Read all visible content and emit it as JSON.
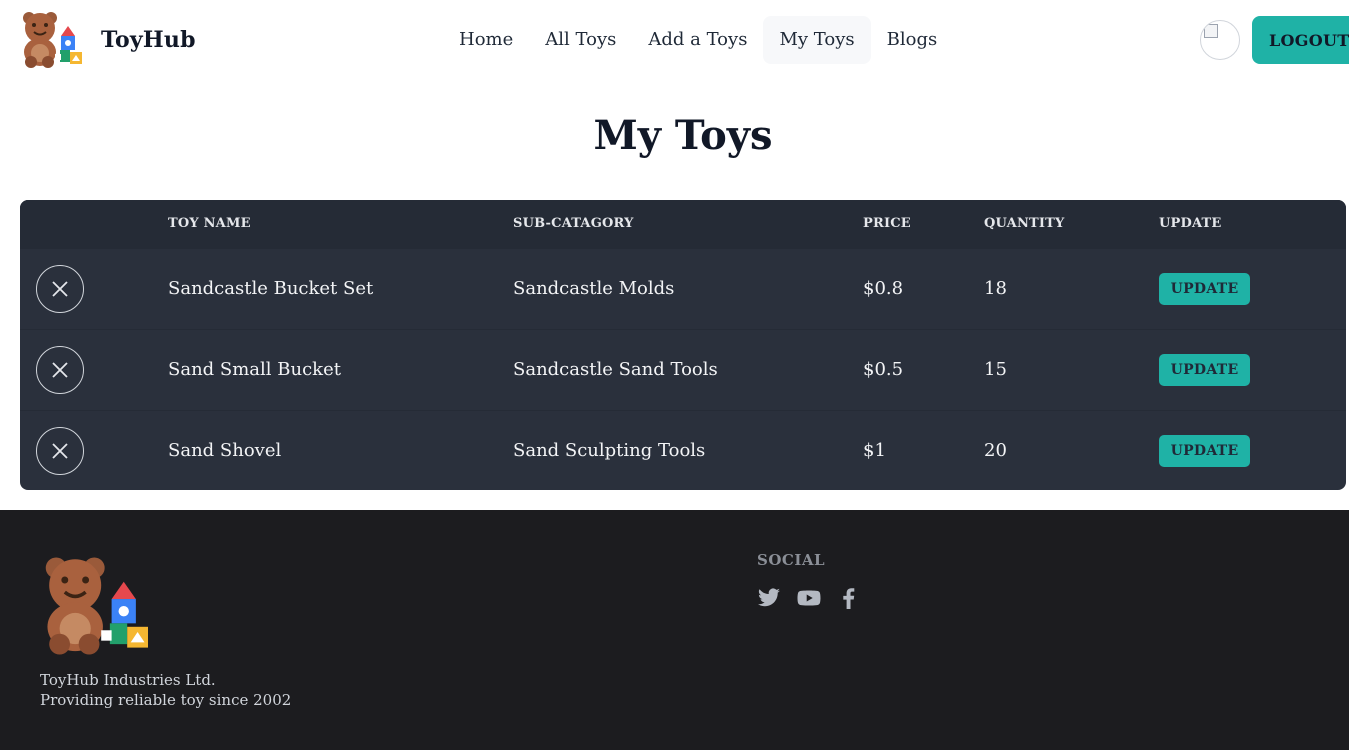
{
  "brand": {
    "name": "ToyHub"
  },
  "nav": {
    "items": [
      {
        "label": "Home",
        "active": false
      },
      {
        "label": "All Toys",
        "active": false
      },
      {
        "label": "Add a Toys",
        "active": false
      },
      {
        "label": "My Toys",
        "active": true
      },
      {
        "label": "Blogs",
        "active": false
      }
    ],
    "logout_label": "LOGOUT"
  },
  "page": {
    "title": "My Toys"
  },
  "table": {
    "headers": [
      "",
      "TOY NAME",
      "SUB-CATAGORY",
      "PRICE",
      "QUANTITY",
      "UPDATE"
    ],
    "rows": [
      {
        "name": "Sandcastle Bucket Set",
        "sub_category": "Sandcastle Molds",
        "price": "$0.8",
        "quantity": "18",
        "update_label": "UPDATE"
      },
      {
        "name": "Sand Small Bucket",
        "sub_category": "Sandcastle Sand Tools",
        "price": "$0.5",
        "quantity": "15",
        "update_label": "UPDATE"
      },
      {
        "name": "Sand Shovel",
        "sub_category": "Sand Sculpting Tools",
        "price": "$1",
        "quantity": "20",
        "update_label": "UPDATE"
      }
    ]
  },
  "footer": {
    "company": "ToyHub Industries Ltd.",
    "tagline": "Providing reliable toy since 2002",
    "social_title": "SOCIAL",
    "social_icons": [
      "twitter-icon",
      "youtube-icon",
      "facebook-icon"
    ]
  },
  "colors": {
    "accent": "#1fb2a6",
    "table_bg": "#2a303c",
    "footer_bg": "#1c1c1f"
  }
}
